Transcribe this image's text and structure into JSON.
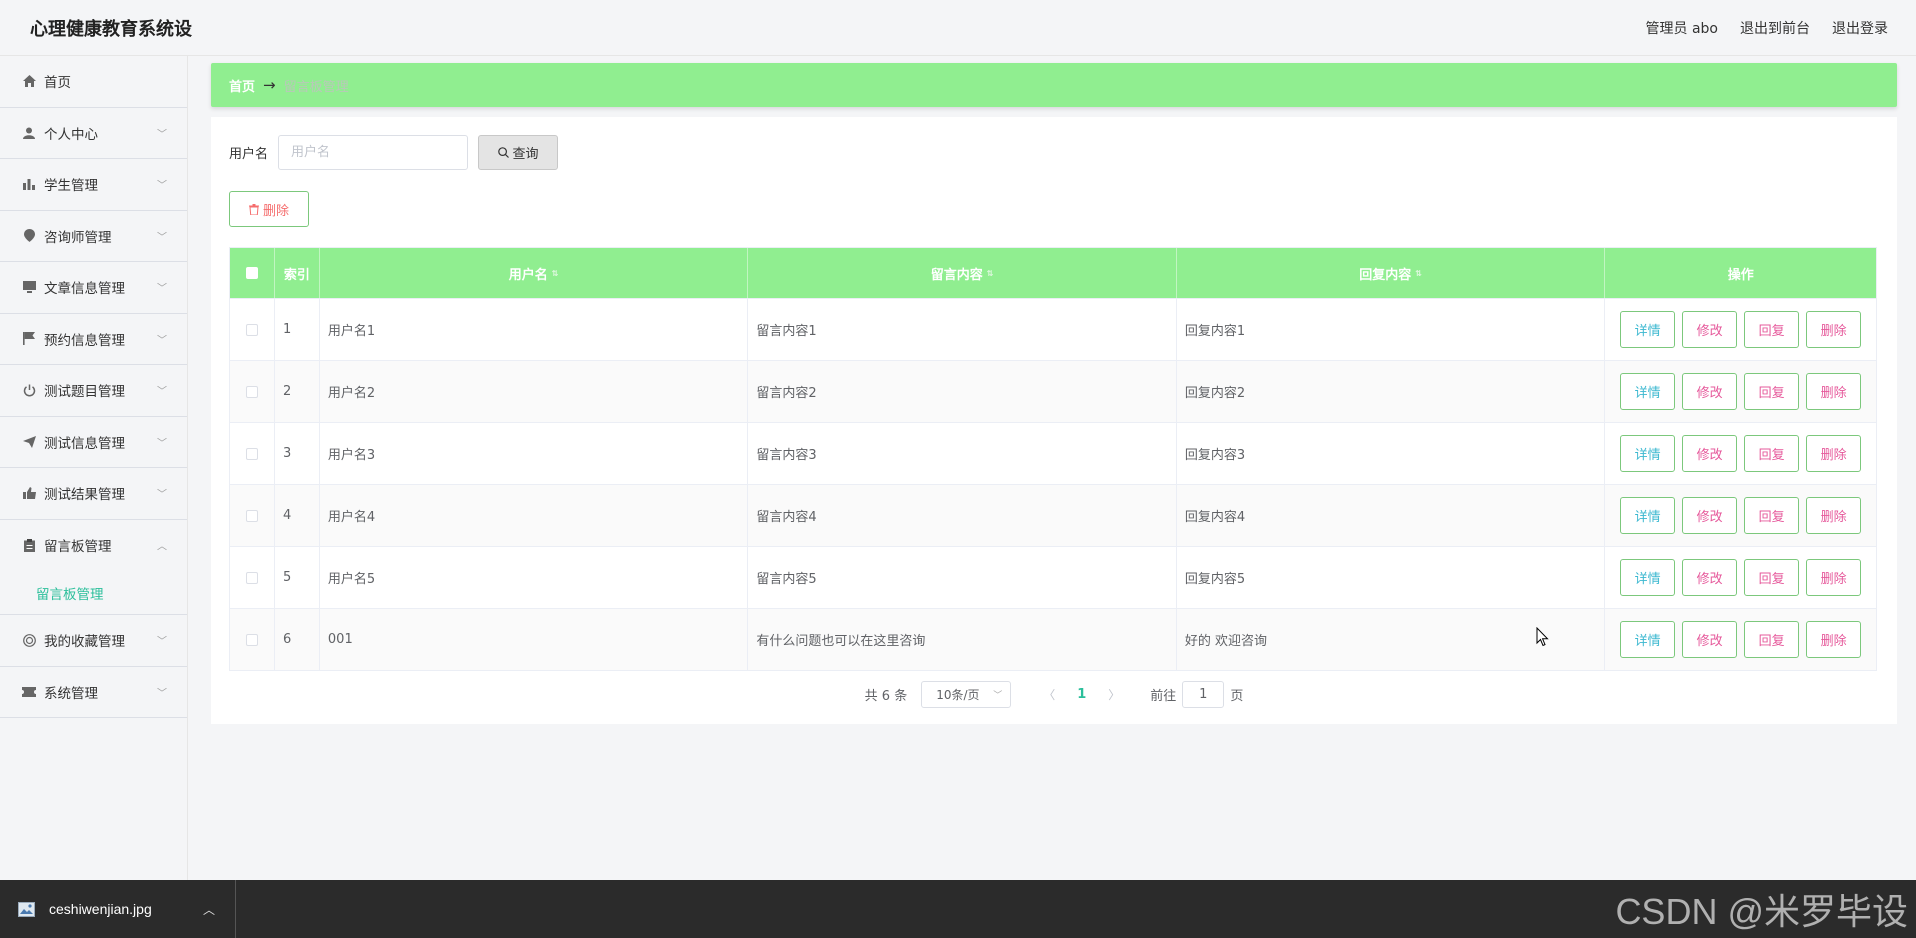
{
  "header": {
    "title": "心理健康教育系统设",
    "admin": "管理员 abo",
    "to_front": "退出到前台",
    "logout": "退出登录"
  },
  "sidebar": {
    "items": [
      {
        "label": "首页",
        "icon": "home-icon"
      },
      {
        "label": "个人中心",
        "icon": "user-icon"
      },
      {
        "label": "学生管理",
        "icon": "bar-chart-icon"
      },
      {
        "label": "咨询师管理",
        "icon": "location-pin-icon"
      },
      {
        "label": "文章信息管理",
        "icon": "monitor-icon"
      },
      {
        "label": "预约信息管理",
        "icon": "flag-icon"
      },
      {
        "label": "测试题目管理",
        "icon": "power-icon"
      },
      {
        "label": "测试信息管理",
        "icon": "send-icon"
      },
      {
        "label": "测试结果管理",
        "icon": "thumb-up-icon"
      },
      {
        "label": "留言板管理",
        "icon": "clipboard-icon"
      },
      {
        "label": "我的收藏管理",
        "icon": "star-circle-icon"
      },
      {
        "label": "系统管理",
        "icon": "ticket-icon"
      }
    ],
    "sub_active": "留言板管理"
  },
  "breadcrumb": {
    "home": "首页",
    "arrow": "→",
    "current": "留言板管理"
  },
  "search": {
    "label": "用户名",
    "placeholder": "用户名",
    "button": "查询"
  },
  "toolbar": {
    "delete": "删除"
  },
  "table": {
    "headers": [
      "索引",
      "用户名",
      "留言内容",
      "回复内容",
      "操作"
    ],
    "rows": [
      {
        "idx": "1",
        "user": "用户名1",
        "msg": "留言内容1",
        "reply": "回复内容1"
      },
      {
        "idx": "2",
        "user": "用户名2",
        "msg": "留言内容2",
        "reply": "回复内容2"
      },
      {
        "idx": "3",
        "user": "用户名3",
        "msg": "留言内容3",
        "reply": "回复内容3"
      },
      {
        "idx": "4",
        "user": "用户名4",
        "msg": "留言内容4",
        "reply": "回复内容4"
      },
      {
        "idx": "5",
        "user": "用户名5",
        "msg": "留言内容5",
        "reply": "回复内容5"
      },
      {
        "idx": "6",
        "user": "001",
        "msg": "有什么问题也可以在这里咨询",
        "reply": "好的 欢迎咨询"
      }
    ],
    "ops": [
      "详情",
      "修改",
      "回复",
      "删除"
    ]
  },
  "pagination": {
    "total": "共 6 条",
    "page_size": "10条/页",
    "current": "1",
    "goto_prefix": "前往",
    "goto_value": "1",
    "goto_suffix": "页"
  },
  "download_bar": {
    "filename": "ceshiwenjian.jpg"
  },
  "watermark": "CSDN @米罗毕设",
  "colors": {
    "accent_green": "#90ee90",
    "active_text": "#2bbf9b",
    "danger": "#e6599b"
  }
}
